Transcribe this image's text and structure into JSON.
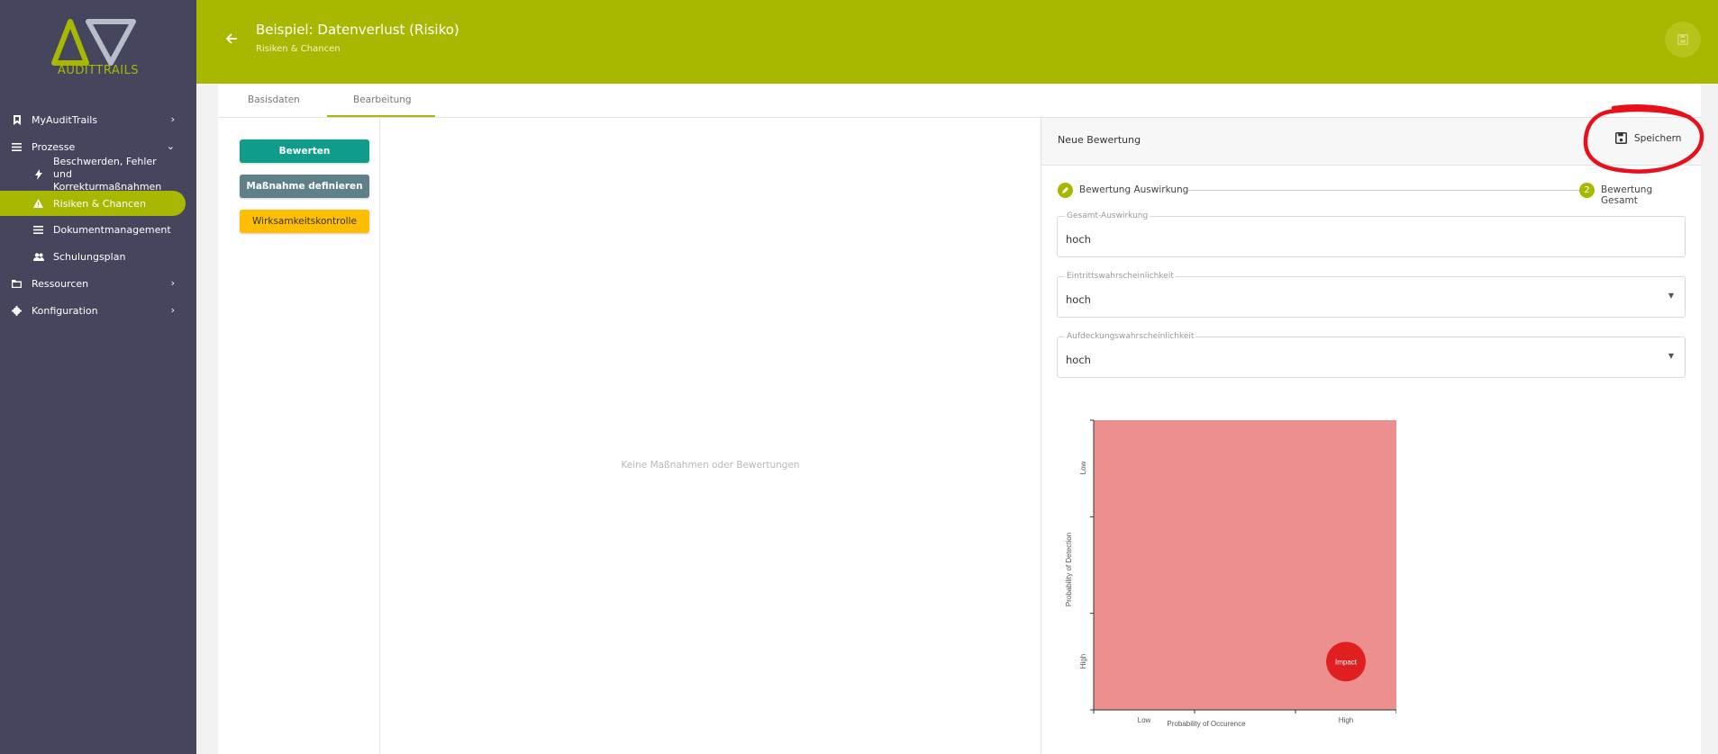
{
  "sidebar": {
    "logo_text_a": "AUDIT",
    "logo_text_b": "TRAILS",
    "items": [
      {
        "label": "MyAuditTrails",
        "icon": "bookmark-icon"
      },
      {
        "label": "Prozesse",
        "icon": "menu-icon"
      },
      {
        "label": "Beschwerden, Fehler und Korrekturmaßnahmen",
        "icon": "bolt-icon"
      },
      {
        "label": "Risiken & Chancen",
        "icon": "warning-icon"
      },
      {
        "label": "Dokumentmanagement",
        "icon": "list-icon"
      },
      {
        "label": "Schulungsplan",
        "icon": "people-icon"
      },
      {
        "label": "Ressourcen",
        "icon": "folder-icon"
      },
      {
        "label": "Konfiguration",
        "icon": "gear-icon"
      }
    ]
  },
  "header": {
    "title": "Beispiel: Datenverlust (Risiko)",
    "subtitle": "Risiken & Chancen"
  },
  "tabs": [
    {
      "label": "Basisdaten"
    },
    {
      "label": "Bearbeitung"
    }
  ],
  "actions": {
    "bewerten": "Bewerten",
    "massnahme": "Maßnahme definieren",
    "wirksamkeit": "Wirksamkeitskontrolle"
  },
  "main": {
    "empty_message": "Keine Maßnahmen oder Bewertungen"
  },
  "panel": {
    "title": "Neue Bewertung",
    "save_label": "Speichern",
    "steps": [
      {
        "label": "Bewertung Auswirkung"
      },
      {
        "label": "Bewertung Gesamt",
        "number": "2"
      }
    ],
    "fields": [
      {
        "label": "Gesamt-Auswirkung",
        "value": "hoch"
      },
      {
        "label": "Eintrittswahrscheinlichkeit",
        "value": "hoch"
      },
      {
        "label": "Aufdeckungswahrscheinlichkeit",
        "value": "hoch"
      }
    ]
  },
  "colors": {
    "brand": "#a8b800",
    "sidebar": "#45465e",
    "teal": "#0f9c8a",
    "slate": "#5f7f89",
    "amber": "#ffbf00"
  },
  "chart_data": {
    "type": "heatmap",
    "xlabel": "Probability of Occurence",
    "ylabel": "Probability of Detection",
    "x_ticks": [
      "Low",
      "High"
    ],
    "y_ticks": [
      "Low",
      "High"
    ],
    "zones": [
      {
        "color": "#ee8f8f",
        "from": 0,
        "to": 3
      },
      {
        "color": "#f0dc55",
        "from": 0,
        "to": 2
      },
      {
        "color": "#c6dc6b",
        "from": 0,
        "to": 1
      }
    ],
    "marker": {
      "label": "Impact",
      "x": 3,
      "y": 3,
      "color": "#e02020"
    }
  }
}
